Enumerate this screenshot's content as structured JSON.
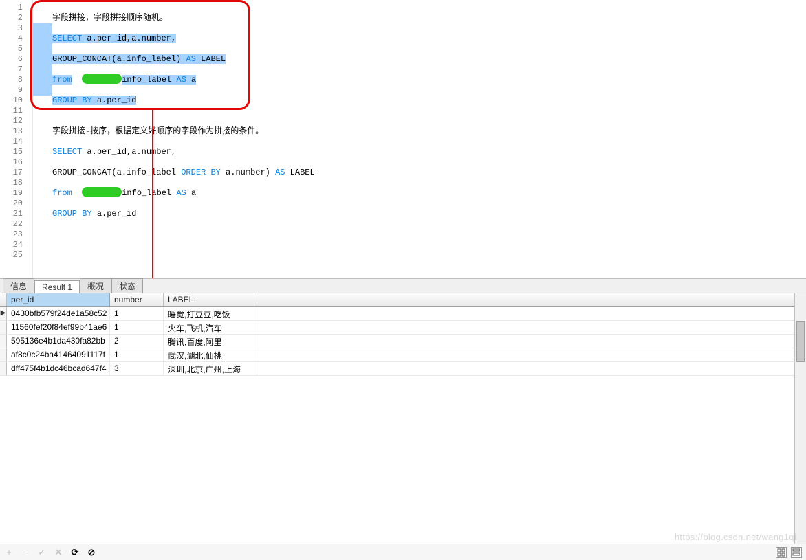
{
  "code_lines": [
    {
      "n": 1,
      "segs": []
    },
    {
      "n": 2,
      "segs": [
        {
          "t": "字段拼接，字段拼接顺序随机。",
          "c": ""
        }
      ]
    },
    {
      "n": 3,
      "segs": [],
      "selmargin": true
    },
    {
      "n": 4,
      "segs": [
        {
          "t": "SELECT",
          "c": "kw",
          "s": true
        },
        {
          "t": " a.per_id,a.number,",
          "c": "",
          "s": true
        }
      ],
      "selmargin": true
    },
    {
      "n": 5,
      "segs": [],
      "selmargin": true
    },
    {
      "n": 6,
      "segs": [
        {
          "t": "GROUP_CONCAT(a.info_label) ",
          "c": "",
          "s": true
        },
        {
          "t": "AS",
          "c": "kw",
          "s": true
        },
        {
          "t": " LABEL",
          "c": "",
          "s": true
        }
      ],
      "selmargin": true
    },
    {
      "n": 7,
      "segs": [],
      "selmargin": true
    },
    {
      "n": 8,
      "segs": [
        {
          "t": "from",
          "c": "kw",
          "s": true
        },
        {
          "t": "  ",
          "c": ""
        },
        {
          "redact": 58
        },
        {
          "t": "info_label ",
          "c": "",
          "s": true
        },
        {
          "t": "AS",
          "c": "kw",
          "s": true
        },
        {
          "t": " a",
          "c": "",
          "s": true
        }
      ],
      "selmargin": true
    },
    {
      "n": 9,
      "segs": [],
      "selmargin": true
    },
    {
      "n": 10,
      "segs": [
        {
          "t": "GROUP",
          "c": "kw",
          "s": true
        },
        {
          "t": " ",
          "c": "",
          "s": true
        },
        {
          "t": "BY",
          "c": "kw",
          "s": true
        },
        {
          "t": " a.per_id",
          "c": "",
          "s": true
        }
      ]
    },
    {
      "n": 11,
      "segs": []
    },
    {
      "n": 12,
      "segs": []
    },
    {
      "n": 13,
      "segs": [
        {
          "t": "字段拼接-按序，根据定义好顺序的字段作为拼接的条件。",
          "c": ""
        }
      ]
    },
    {
      "n": 14,
      "segs": []
    },
    {
      "n": 15,
      "segs": [
        {
          "t": "SELECT",
          "c": "kw"
        },
        {
          "t": " a.per_id,a.number,",
          "c": ""
        }
      ]
    },
    {
      "n": 16,
      "segs": []
    },
    {
      "n": 17,
      "segs": [
        {
          "t": "GROUP_CONCAT(a.info_label ",
          "c": ""
        },
        {
          "t": "ORDER",
          "c": "kw"
        },
        {
          "t": " ",
          "c": ""
        },
        {
          "t": "BY",
          "c": "kw"
        },
        {
          "t": " a.number) ",
          "c": ""
        },
        {
          "t": "AS",
          "c": "kw"
        },
        {
          "t": " LABEL",
          "c": ""
        }
      ]
    },
    {
      "n": 18,
      "segs": []
    },
    {
      "n": 19,
      "segs": [
        {
          "t": "from",
          "c": "kw"
        },
        {
          "t": "  ",
          "c": ""
        },
        {
          "redact": 58
        },
        {
          "t": "info_label ",
          "c": ""
        },
        {
          "t": "AS",
          "c": "kw"
        },
        {
          "t": " a",
          "c": ""
        }
      ]
    },
    {
      "n": 20,
      "segs": []
    },
    {
      "n": 21,
      "segs": [
        {
          "t": "GROUP",
          "c": "kw"
        },
        {
          "t": " ",
          "c": ""
        },
        {
          "t": "BY",
          "c": "kw"
        },
        {
          "t": " a.per_id",
          "c": ""
        }
      ]
    },
    {
      "n": 22,
      "segs": []
    },
    {
      "n": 23,
      "segs": []
    },
    {
      "n": 24,
      "segs": []
    },
    {
      "n": 25,
      "segs": []
    }
  ],
  "tabs": {
    "info": "信息",
    "result": "Result 1",
    "profile": "概况",
    "status": "状态"
  },
  "grid": {
    "headers": {
      "per_id": "per_id",
      "number": "number",
      "label": "LABEL"
    },
    "colw": {
      "marker": 10,
      "per_id": 150,
      "number": 78,
      "label": 136
    },
    "rows": [
      {
        "marker": "▶",
        "per_id": "0430bfb579f24de1a58c52",
        "number": "1",
        "label": "睡觉,打豆豆,吃饭"
      },
      {
        "marker": "",
        "per_id": "11560fef20f84ef99b41ae6",
        "number": "1",
        "label": "火车,飞机,汽车"
      },
      {
        "marker": "",
        "per_id": "595136e4b1da430fa82bb",
        "number": "2",
        "label": "腾讯,百度,阿里"
      },
      {
        "marker": "",
        "per_id": "af8c0c24ba41464091117f",
        "number": "1",
        "label": "武汉,湖北,仙桃"
      },
      {
        "marker": "",
        "per_id": "dff475f4b1dc46bcad647f4",
        "number": "3",
        "label": "深圳,北京,广州,上海"
      }
    ]
  },
  "footer_tools": {
    "add": "+",
    "remove": "−",
    "apply": "✓",
    "cancel": "✕",
    "refresh": "⟳",
    "stop": "⊘"
  },
  "watermark": "https://blog.csdn.net/wang1qi"
}
